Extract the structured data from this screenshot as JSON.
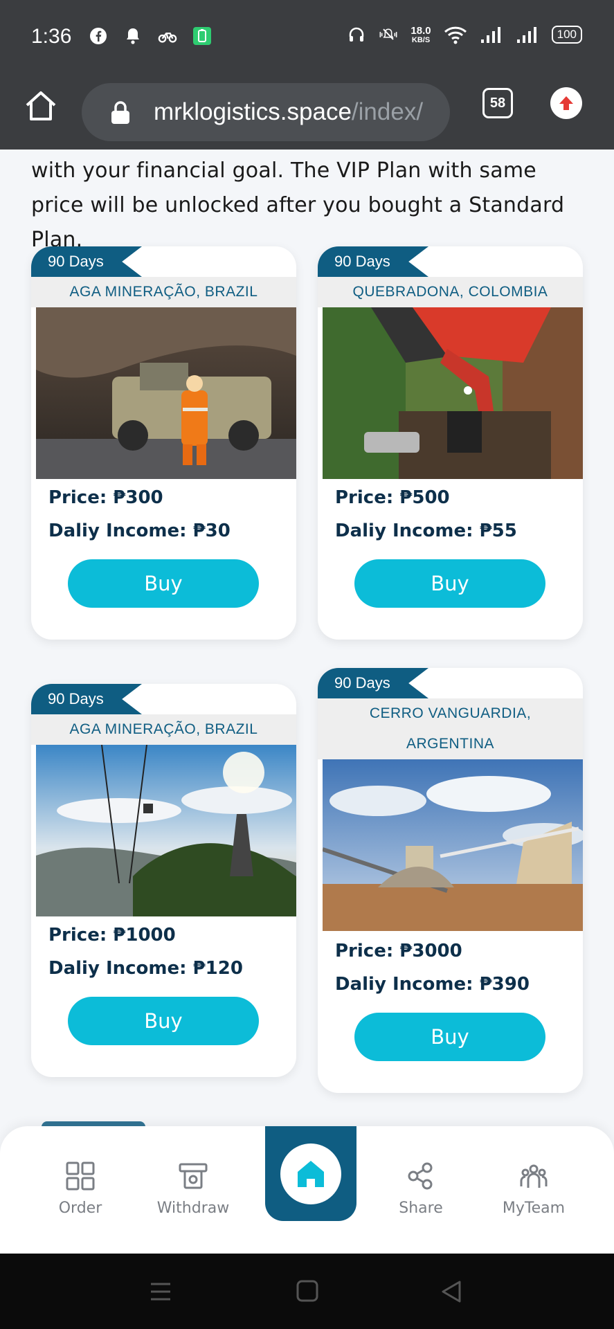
{
  "status_bar": {
    "time": "1:36",
    "speed_value": "18.0",
    "speed_unit": "KB/S",
    "battery": "100"
  },
  "browser": {
    "url_main": "mrklogistics.space",
    "url_path": "/index/",
    "tab_count": "58"
  },
  "intro_text": "with your financial goal. The VIP Plan with same price will be unlocked after you bought a Standard Plan.",
  "plans": [
    {
      "days": "90 Days",
      "location": "AGA MINERAÇÃO, BRAZIL",
      "price": "Price: ₱300",
      "income": "Daliy Income: ₱30",
      "buy": "Buy"
    },
    {
      "days": "90 Days",
      "location": "QUEBRADONA, COLOMBIA",
      "price": "Price: ₱500",
      "income": "Daliy Income: ₱55",
      "buy": "Buy"
    },
    {
      "days": "90 Days",
      "location": "AGA MINERAÇÃO, BRAZIL",
      "price": "Price: ₱1000",
      "income": "Daliy Income: ₱120",
      "buy": "Buy"
    },
    {
      "days": "90 Days",
      "location_line1": "CERRO VANGUARDIA,",
      "location_line2": "ARGENTINA",
      "price": "Price: ₱3000",
      "income": "Daliy Income: ₱390",
      "buy": "Buy"
    }
  ],
  "bottom_nav": {
    "order": "Order",
    "withdraw": "Withdraw",
    "share": "Share",
    "myteam": "MyTeam"
  },
  "colors": {
    "primary": "#0f5d82",
    "button": "#0cbcd8",
    "chrome": "#3b3d40"
  }
}
